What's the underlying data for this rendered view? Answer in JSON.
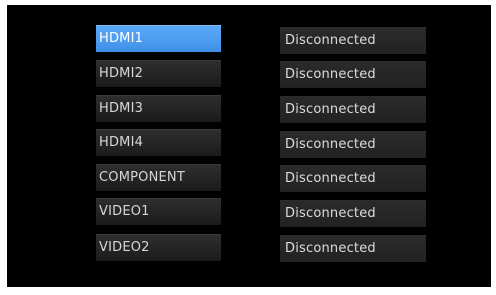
{
  "inputs": [
    {
      "label": "HDMI1",
      "status": "Disconnected",
      "selected": true
    },
    {
      "label": "HDMI2",
      "status": "Disconnected",
      "selected": false
    },
    {
      "label": "HDMI3",
      "status": "Disconnected",
      "selected": false
    },
    {
      "label": "HDMI4",
      "status": "Disconnected",
      "selected": false
    },
    {
      "label": "COMPONENT",
      "status": "Disconnected",
      "selected": false
    },
    {
      "label": "VIDEO1",
      "status": "Disconnected",
      "selected": false
    },
    {
      "label": "VIDEO2",
      "status": "Disconnected",
      "selected": false
    }
  ],
  "colors": {
    "background": "#000000",
    "selected": "#4d9cf0",
    "item": "#242424",
    "text": "#dcdcdc"
  }
}
